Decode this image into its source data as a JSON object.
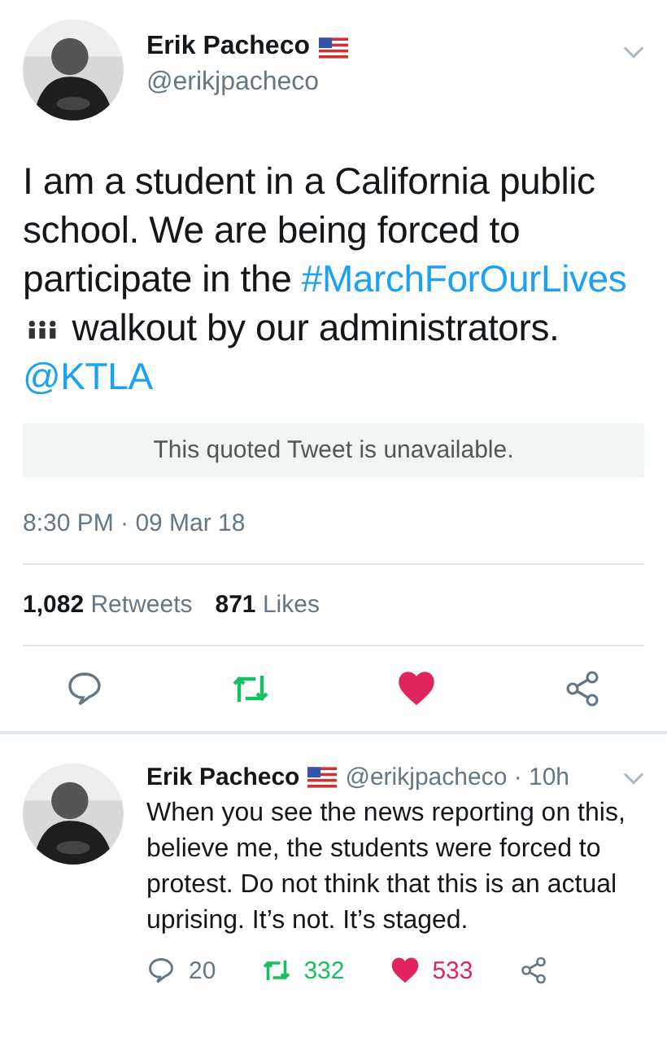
{
  "tweet": {
    "name": "Erik Pacheco",
    "handle": "@erikjpacheco",
    "text": [
      {
        "kind": "text",
        "text": "I am a student in a California public school. We are being forced to participate in the "
      },
      {
        "kind": "hashtag",
        "text": "#MarchForOurLives"
      },
      {
        "kind": "icon"
      },
      {
        "kind": "text",
        "text": " walkout by our administrators. "
      },
      {
        "kind": "mention",
        "text": "@KTLA"
      }
    ],
    "quoted": "This quoted Tweet is unavailable.",
    "time": "8:30 PM · 09 Mar 18",
    "retweets_count": "1,082",
    "retweets_label": "Retweets",
    "likes_count": "871",
    "likes_label": "Likes",
    "retweeted": true,
    "liked": true
  },
  "reply": {
    "name": "Erik Pacheco",
    "handle": "@erikjpacheco · 10h",
    "text": "When you see the news reporting on this, believe me, the students were forced to protest. Do not think that this is an actual uprising. It’s not. It’s staged.",
    "replies": "20",
    "retweets": "332",
    "likes": "533",
    "retweeted": true,
    "liked": true
  }
}
